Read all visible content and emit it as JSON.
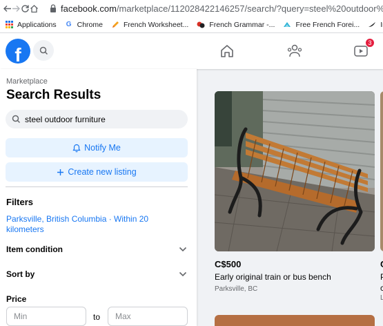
{
  "browser": {
    "url_host": "facebook.com",
    "url_path": "/marketplace/112028422146257/search/?query=steel%20outdoor%"
  },
  "bookmarks": [
    {
      "label": "Applications",
      "icon": "apps-grid-icon"
    },
    {
      "label": "Chrome",
      "icon": "google-g-icon"
    },
    {
      "label": "French Worksheet...",
      "icon": "pencil-icon"
    },
    {
      "label": "French Grammar -...",
      "icon": "french-grammar-icon"
    },
    {
      "label": "Free French Forei...",
      "icon": "arrow-bookmark-icon"
    },
    {
      "label": "In",
      "icon": "swoosh-icon"
    }
  ],
  "fbnav": {
    "logo_letter": "f",
    "notification_badge": "3"
  },
  "sidebar": {
    "subtitle": "Marketplace",
    "title": "Search Results",
    "search_value": "steel outdoor furniture",
    "notify_label": "Notify Me",
    "create_listing_label": "Create new listing",
    "filters_heading": "Filters",
    "location": "Parksville, British Columbia · Within 20 kilometers",
    "item_condition": "Item condition",
    "sort_by": "Sort by",
    "price_label": "Price",
    "min_placeholder": "Min",
    "to_label": "to",
    "max_placeholder": "Max"
  },
  "listings": [
    {
      "price": "C$500",
      "title": "Early original train or bus bench",
      "location": "Parksville, BC"
    }
  ],
  "peek": {
    "price_initial": "C",
    "line1": "P",
    "line2": "c",
    "line3": "L"
  },
  "colors": {
    "brand_blue": "#1877f2",
    "light_blue_bg": "#e7f3ff",
    "badge_red": "#e41e3f"
  }
}
